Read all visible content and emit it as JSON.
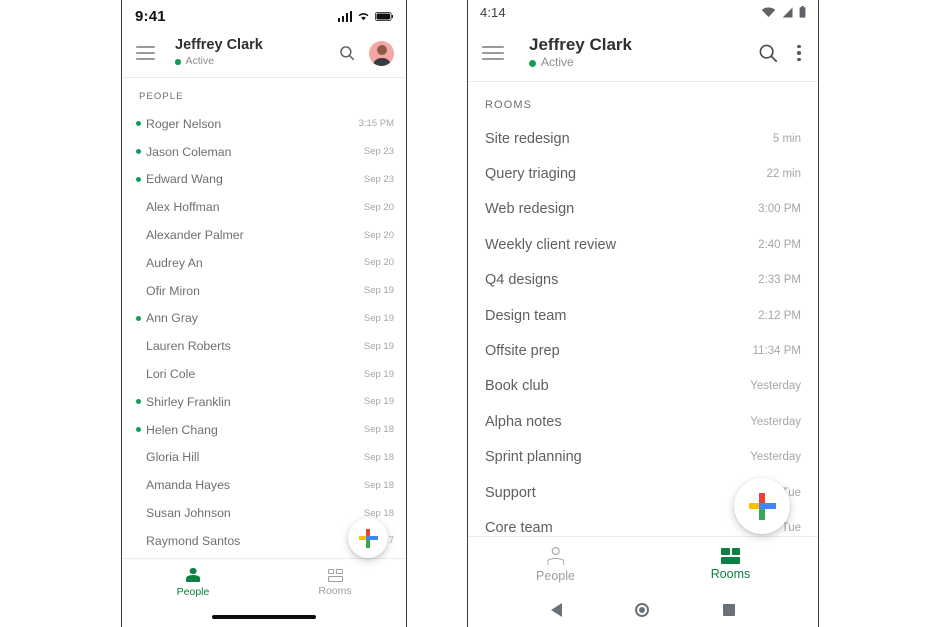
{
  "left_phone": {
    "status_bar": {
      "time": "9:41",
      "icons": [
        "cellular-bars-icon",
        "wifi-icon",
        "battery-icon"
      ]
    },
    "app_bar": {
      "menu_icon": "hamburger-menu-icon",
      "title": "Jeffrey Clark",
      "status_text": "Active",
      "status_color": "#0f9d58",
      "search_icon": "search-icon",
      "avatar": "user-avatar"
    },
    "section_header": "PEOPLE",
    "people": [
      {
        "name": "Roger Nelson",
        "time": "3:15 PM",
        "online": true
      },
      {
        "name": "Jason Coleman",
        "time": "Sep 23",
        "online": true
      },
      {
        "name": "Edward Wang",
        "time": "Sep 23",
        "online": true
      },
      {
        "name": "Alex Hoffman",
        "time": "Sep 20",
        "online": false
      },
      {
        "name": "Alexander Palmer",
        "time": "Sep 20",
        "online": false
      },
      {
        "name": "Audrey An",
        "time": "Sep 20",
        "online": false
      },
      {
        "name": "Ofir Miron",
        "time": "Sep 19",
        "online": false
      },
      {
        "name": "Ann Gray",
        "time": "Sep 19",
        "online": true
      },
      {
        "name": "Lauren Roberts",
        "time": "Sep 19",
        "online": false
      },
      {
        "name": "Lori Cole",
        "time": "Sep 19",
        "online": false
      },
      {
        "name": "Shirley Franklin",
        "time": "Sep 19",
        "online": true
      },
      {
        "name": "Helen Chang",
        "time": "Sep 18",
        "online": true
      },
      {
        "name": "Gloria Hill",
        "time": "Sep 18",
        "online": false
      },
      {
        "name": "Amanda Hayes",
        "time": "Sep 18",
        "online": false
      },
      {
        "name": "Susan Johnson",
        "time": "Sep 18",
        "online": false
      },
      {
        "name": "Raymond Santos",
        "time": "Sep 17",
        "online": false
      }
    ],
    "fab": {
      "icon": "google-plus-icon",
      "label": ""
    },
    "bottom_nav": {
      "tabs": [
        {
          "label": "People",
          "icon": "person-icon",
          "active": true
        },
        {
          "label": "Rooms",
          "icon": "rooms-grid-icon",
          "active": false
        }
      ]
    },
    "home_indicator": "home-indicator"
  },
  "right_phone": {
    "status_bar": {
      "time": "4:14",
      "icons": [
        "wifi-icon",
        "cellular-signal-icon",
        "battery-icon"
      ]
    },
    "app_bar": {
      "menu_icon": "hamburger-menu-icon",
      "title": "Jeffrey Clark",
      "status_text": "Active",
      "status_color": "#0f9d58",
      "search_icon": "search-icon",
      "overflow_icon": "more-vertical-icon"
    },
    "section_header": "ROOMS",
    "rooms": [
      {
        "name": "Site redesign",
        "time": "5 min"
      },
      {
        "name": "Query triaging",
        "time": "22 min"
      },
      {
        "name": "Web redesign",
        "time": "3:00 PM"
      },
      {
        "name": "Weekly client review",
        "time": "2:40 PM"
      },
      {
        "name": "Q4 designs",
        "time": "2:33 PM"
      },
      {
        "name": "Design team",
        "time": "2:12 PM"
      },
      {
        "name": "Offsite prep",
        "time": "11:34 PM"
      },
      {
        "name": "Book club",
        "time": "Yesterday"
      },
      {
        "name": "Alpha notes",
        "time": "Yesterday"
      },
      {
        "name": "Sprint planning",
        "time": "Yesterday"
      },
      {
        "name": "Support",
        "time": "Tue"
      },
      {
        "name": "Core team",
        "time": "Tue"
      }
    ],
    "fab": {
      "icon": "google-plus-icon",
      "label": ""
    },
    "bottom_nav": {
      "tabs": [
        {
          "label": "People",
          "icon": "person-icon",
          "active": false
        },
        {
          "label": "Rooms",
          "icon": "rooms-grid-icon",
          "active": true
        }
      ]
    },
    "system_nav": {
      "back": "back-triangle-icon",
      "home": "home-circle-icon",
      "recents": "recents-square-icon"
    }
  },
  "theme": {
    "accent_green": "#0b8043",
    "online_green": "#0f9d58",
    "text_primary": "#30302f",
    "text_secondary": "#6f6f6f",
    "text_muted": "#a6a6a6",
    "google_red": "#ea4335",
    "google_yellow": "#fbbc05",
    "google_blue": "#4285f4",
    "google_green": "#34a853"
  }
}
